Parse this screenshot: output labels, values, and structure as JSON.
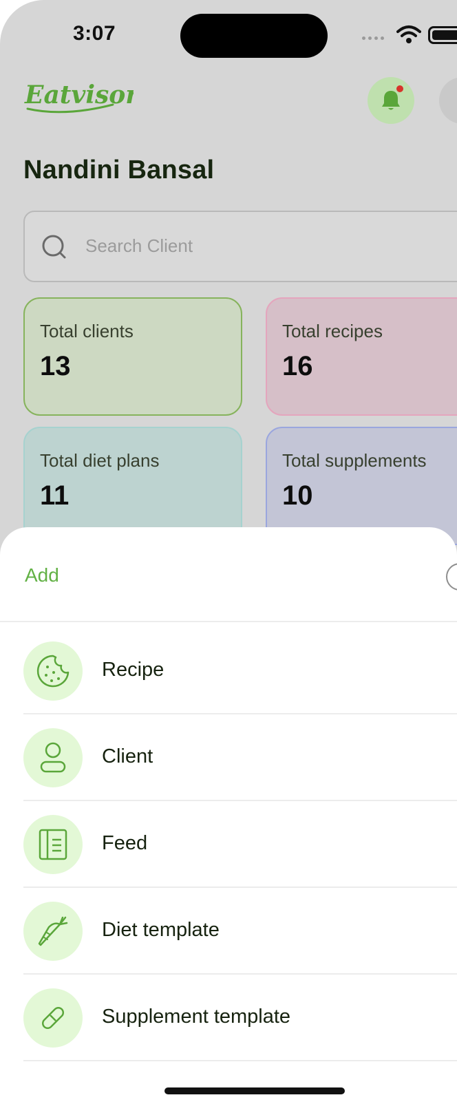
{
  "status_bar": {
    "time": "3:07"
  },
  "header": {
    "logo_text": "Eatvisor",
    "user_name": "Nandini Bansal"
  },
  "search": {
    "placeholder": "Search Client"
  },
  "stats": [
    {
      "label": "Total clients",
      "value": "13"
    },
    {
      "label": "Total recipes",
      "value": "16"
    },
    {
      "label": "Total diet plans",
      "value": "11"
    },
    {
      "label": "Total supplements",
      "value": "10"
    }
  ],
  "sheet": {
    "title": "Add",
    "options": [
      {
        "label": "Recipe",
        "icon": "cookie-icon"
      },
      {
        "label": "Client",
        "icon": "user-icon"
      },
      {
        "label": "Feed",
        "icon": "feed-icon"
      },
      {
        "label": "Diet template",
        "icon": "carrot-icon"
      },
      {
        "label": "Supplement template",
        "icon": "pill-icon"
      }
    ]
  },
  "colors": {
    "brand_green": "#62b145",
    "icon_bg": "#e3f8d6",
    "notification_dot": "#d7342b"
  }
}
